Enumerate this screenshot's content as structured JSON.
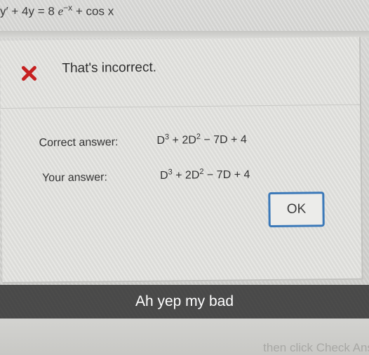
{
  "problem": {
    "equation_lhs": "y′ + 4y = 8",
    "equation_e": "e",
    "equation_exp": "−x",
    "equation_rhs": "+ cos x"
  },
  "dialog": {
    "icon": "close-icon",
    "icon_color": "#c62020",
    "status_text": "That's incorrect.",
    "correct_label": "Correct answer:",
    "your_label": "Your answer:",
    "correct_answer": {
      "a": "D",
      "a_exp": "3",
      "b": " + 2D",
      "b_exp": "2",
      "c": " − 7D + 4"
    },
    "your_answer": {
      "a": "D",
      "a_exp": "3",
      "b": " + 2D",
      "b_exp": "2",
      "c": " − 7D + 4"
    },
    "ok_label": "OK",
    "ok_border_color": "#3a78b8"
  },
  "caption": {
    "text": "Ah yep my bad"
  },
  "footer": {
    "partial_text": "then click Check Ans"
  }
}
